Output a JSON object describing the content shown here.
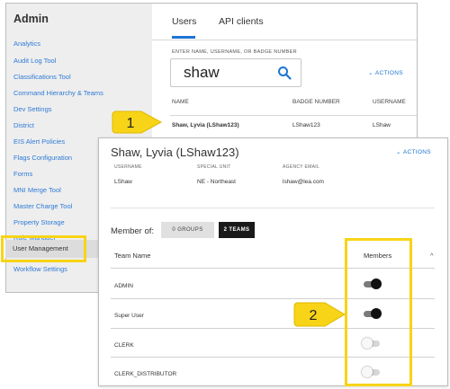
{
  "sidebar": {
    "title": "Admin",
    "items": [
      {
        "label": "Analytics"
      },
      {
        "label": "Audit Log Tool"
      },
      {
        "label": "Classifications Tool"
      },
      {
        "label": "Command Hierarchy & Teams"
      },
      {
        "label": "Dev Settings"
      },
      {
        "label": "District"
      },
      {
        "label": "EIS Alert Policies"
      },
      {
        "label": "Flags Configuration"
      },
      {
        "label": "Forms"
      },
      {
        "label": "MNI Merge Tool"
      },
      {
        "label": "Master Charge Tool"
      },
      {
        "label": "Property Storage"
      },
      {
        "label": "Rule Manager"
      },
      {
        "label": "User Management"
      },
      {
        "label": "Workflow Settings"
      }
    ],
    "active_item": "User Management"
  },
  "tabs": [
    {
      "label": "Users"
    },
    {
      "label": "API clients"
    }
  ],
  "search": {
    "label": "ENTER NAME, USERNAME, OR BADGE NUMBER",
    "value": "shaw",
    "icon": "search-icon"
  },
  "actions_label": "ACTIONS",
  "users_table": {
    "headers": [
      "NAME",
      "BADGE NUMBER",
      "USERNAME"
    ],
    "rows": [
      {
        "name": "Shaw, Lyvia (LShaw123)",
        "badge": "LShaw123",
        "username": "LShaw"
      }
    ]
  },
  "user_detail": {
    "title": "Shaw, Lyvia (LShaw123)",
    "actions_label": "ACTIONS",
    "fields": [
      {
        "label": "USERNAME",
        "value": "LShaw"
      },
      {
        "label": "SPECIAL UNIT",
        "value": "NE - Northeast"
      },
      {
        "label": "AGENCY EMAIL",
        "value": "lshaw@lea.com"
      }
    ],
    "member_of_label": "Member of:",
    "groups_button": "0 GROUPS",
    "teams_button": "2 TEAMS",
    "teams_table": {
      "headers": {
        "team_name": "Team Name",
        "members": "Members"
      },
      "rows": [
        {
          "name": "ADMIN",
          "member": true
        },
        {
          "name": "Super User",
          "member": true
        },
        {
          "name": "CLERK",
          "member": false
        },
        {
          "name": "CLERK_DISTRIBUTOR",
          "member": false
        }
      ]
    }
  },
  "callouts": [
    {
      "number": "1"
    },
    {
      "number": "2"
    }
  ],
  "colors": {
    "accent": "#1e74d4",
    "highlight": "#f7d417"
  }
}
